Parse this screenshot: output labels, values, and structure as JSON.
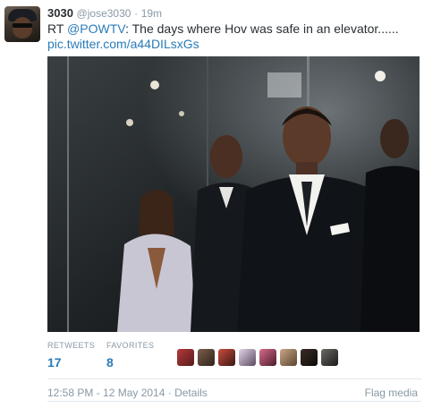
{
  "tweet": {
    "display_name": "3030",
    "handle": "@jose3030",
    "separator": "·",
    "time_ago": "19m",
    "text_prefix": "RT ",
    "mention": "@POWTV",
    "text_body": ": The days where Hov was safe in an elevator......",
    "pic_link": "pic.twitter.com/a44DILsxGs"
  },
  "stats": {
    "retweets_label": "RETWEETS",
    "retweets_count": "17",
    "favorites_label": "FAVORITES",
    "favorites_count": "8",
    "favoriter_avatars": [
      "avatar-1",
      "avatar-2",
      "avatar-3",
      "avatar-4",
      "avatar-5",
      "avatar-6",
      "avatar-7",
      "avatar-8"
    ]
  },
  "meta": {
    "timestamp": "12:58 PM - 12 May 2014",
    "separator": " · ",
    "details_label": "Details",
    "flag_label": "Flag media"
  },
  "colors": {
    "link": "#2b7bb9",
    "muted": "#8899a6",
    "text": "#292f33"
  }
}
